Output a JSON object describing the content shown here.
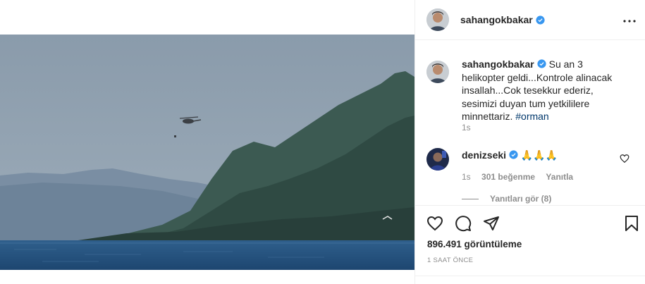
{
  "post": {
    "author": "sahangokbakar",
    "verified": true
  },
  "header": {
    "username": "sahangokbakar",
    "more_icon": "more-horizontal-icon"
  },
  "caption": {
    "username": "sahangokbakar",
    "text": "Su an 3 helikopter geldi...Kontrole alinacak insallah...Cok tesekkur ederiz, sesimizi duyan tum yetkililere minnettariz.",
    "hashtag": "#orman",
    "time": "1s"
  },
  "comment": {
    "username": "denizseki",
    "text": "🙏🙏🙏",
    "time": "1s",
    "likes": "301 beğenme",
    "reply": "Yanıtla",
    "view_replies": "Yanıtları gör (8)"
  },
  "actions": {
    "like_icon": "heart-icon",
    "comment_icon": "comment-icon",
    "share_icon": "send-icon",
    "save_icon": "bookmark-icon"
  },
  "stats": {
    "views": "896.491 görüntüleme",
    "timestamp": "1 SAAT ÖNCE"
  },
  "colors": {
    "verified": "#3897f0",
    "link": "#00376b",
    "muted": "#8e8e8e"
  },
  "video": {
    "mute_icon": "muted-speaker-icon"
  }
}
